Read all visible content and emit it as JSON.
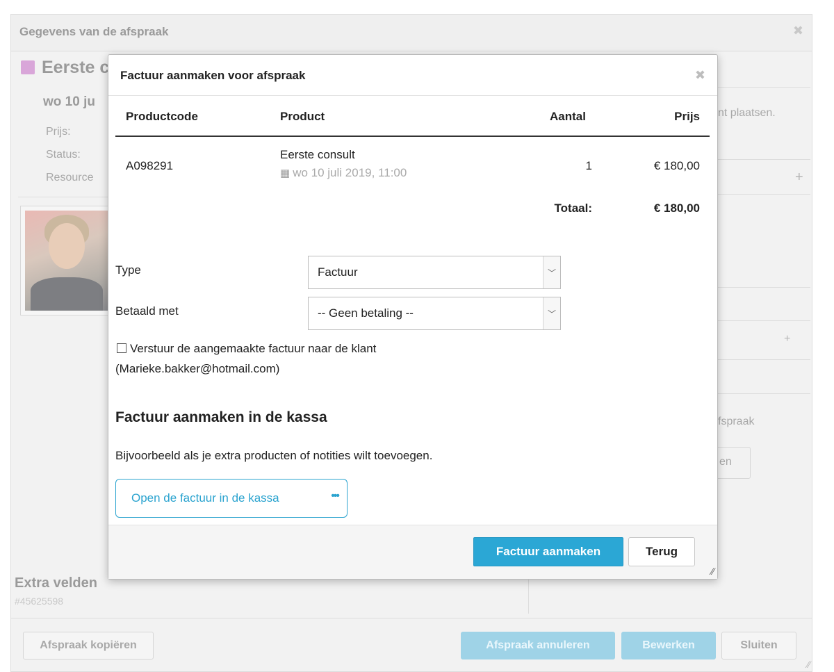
{
  "background": {
    "title": "Gegevens van de afspraak",
    "close_glyph": "✖",
    "appointment_name": "Eerste c",
    "date": "wo 10 ju",
    "labels": [
      "Prijs:",
      "Status:",
      "Resource"
    ],
    "right_texts": {
      "placeholder": "nt plaatsen.",
      "afspraak": "fspraak",
      "button_partial": "en"
    },
    "extra_fields_title": "Extra velden",
    "appointment_id": "#45625598",
    "buttons": {
      "copy": "Afspraak kopiëren",
      "cancel": "Afspraak annuleren",
      "edit": "Bewerken",
      "close": "Sluiten"
    },
    "colors": {
      "swatch": "#d9a6d9"
    }
  },
  "modal": {
    "title": "Factuur aanmaken voor afspraak",
    "close_glyph": "✖",
    "table": {
      "headers": {
        "code": "Productcode",
        "product": "Product",
        "quantity": "Aantal",
        "price": "Prijs"
      },
      "rows": [
        {
          "code": "A098291",
          "product": "Eerste consult",
          "date": "wo 10 juli 2019, 11:00",
          "quantity": "1",
          "price": "€ 180,00"
        }
      ],
      "total_label": "Totaal:",
      "total_value": "€ 180,00"
    },
    "form": {
      "type_label": "Type",
      "type_value": "Factuur",
      "paid_label": "Betaald met",
      "paid_value": "-- Geen betaling --",
      "send_checkbox_label": "Verstuur de aangemaakte factuur naar de klant",
      "send_checkbox_checked": false,
      "client_email": "(Marieke.bakker@hotmail.com)"
    },
    "kassa_section": {
      "title": "Factuur aanmaken in de kassa",
      "description": "Bijvoorbeeld als je extra producten of notities wilt toevoegen.",
      "open_button": "Open de factuur in de kassa",
      "open_button_dots": "•••"
    },
    "footer": {
      "create_button": "Factuur aanmaken",
      "back_button": "Terug"
    },
    "colors": {
      "accent": "#2ba7d5"
    }
  }
}
